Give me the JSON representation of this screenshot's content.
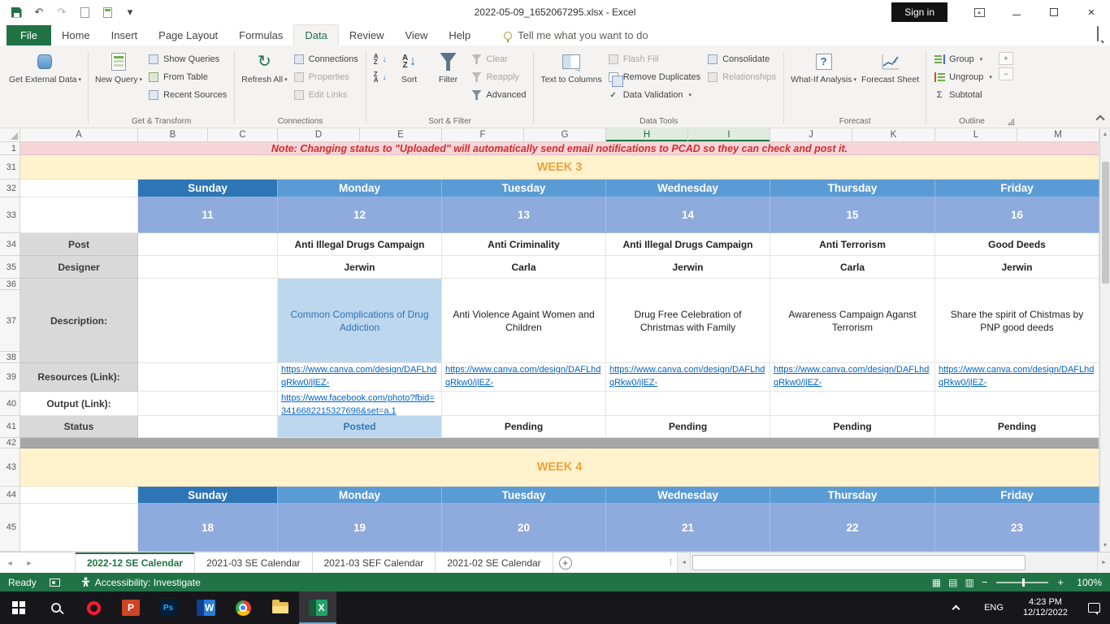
{
  "titlebar": {
    "title": "2022-05-09_1652067295.xlsx  -  Excel",
    "sign_in": "Sign in"
  },
  "tabs": {
    "file": "File",
    "home": "Home",
    "insert": "Insert",
    "page_layout": "Page Layout",
    "formulas": "Formulas",
    "data": "Data",
    "review": "Review",
    "view": "View",
    "help": "Help",
    "tell_me": "Tell me what you want to do"
  },
  "ribbon": {
    "get_external_data": "Get External Data",
    "new_query": "New Query",
    "show_queries": "Show Queries",
    "from_table": "From Table",
    "recent_sources": "Recent Sources",
    "get_transform_label": "Get & Transform",
    "refresh_all": "Refresh All",
    "connections": "Connections",
    "properties": "Properties",
    "edit_links": "Edit Links",
    "connections_label": "Connections",
    "sort": "Sort",
    "filter": "Filter",
    "clear": "Clear",
    "reapply": "Reapply",
    "advanced": "Advanced",
    "sort_filter_label": "Sort & Filter",
    "text_to_columns": "Text to Columns",
    "flash_fill": "Flash Fill",
    "remove_duplicates": "Remove Duplicates",
    "data_validation": "Data Validation",
    "consolidate": "Consolidate",
    "relationships": "Relationships",
    "data_tools_label": "Data Tools",
    "what_if_analysis": "What-If Analysis",
    "forecast_sheet": "Forecast Sheet",
    "forecast_label": "Forecast",
    "group": "Group",
    "ungroup": "Ungroup",
    "subtotal": "Subtotal",
    "outline_label": "Outline"
  },
  "grid": {
    "columns": [
      "A",
      "B",
      "C",
      "D",
      "E",
      "F",
      "G",
      "H",
      "I",
      "J",
      "K",
      "L",
      "M"
    ],
    "rows": [
      "1",
      "31",
      "32",
      "33",
      "34",
      "35",
      "36",
      "37",
      "38",
      "39",
      "40",
      "41",
      "42",
      "43",
      "44",
      "45"
    ],
    "note": "Note: Changing status to \"Uploaded\" will automatically send email notifications to PCAD so they can check and post it.",
    "labels": {
      "post": "Post",
      "designer": "Designer",
      "description": "Description:",
      "resources": "Resources (Link):",
      "output": "Output (Link):",
      "status": "Status"
    },
    "week3": {
      "title": "WEEK 3",
      "days": [
        "Sunday",
        "Monday",
        "Tuesday",
        "Wednesday",
        "Thursday",
        "Friday"
      ],
      "dates": [
        "11",
        "12",
        "13",
        "14",
        "15",
        "16"
      ],
      "posts": [
        "",
        "Anti Illegal Drugs Campaign",
        "Anti Criminality",
        "Anti Illegal Drugs Campaign",
        "Anti Terrorism",
        "Good Deeds"
      ],
      "designers": [
        "",
        "Jerwin",
        "Carla",
        "Jerwin",
        "Carla",
        "Jerwin"
      ],
      "descriptions": [
        "",
        "Common Complications of Drug Addiction",
        "Anti Violence Againt Women and Children",
        "Drug Free Celebration of Christmas with Family",
        "Awareness Campaign Aganst Terrorism",
        "Share the spirit of Chistmas by PNP good deeds"
      ],
      "resources": [
        "",
        "https://www.canva.com/design/DAFLhdqRkw0/jlEZ-",
        "https://www.canva.com/design/DAFLhdqRkw0/jlEZ-",
        "https://www.canva.com/design/DAFLhdqRkw0/jlEZ-",
        "https://www.canva.com/design/DAFLhdqRkw0/jlEZ-",
        "https://www.canva.com/design/DAFLhdqRkw0/jlEZ-"
      ],
      "outputs": [
        "",
        "https://www.facebook.com/photo?fbid=3416682215327696&set=a.1",
        "",
        "",
        "",
        ""
      ],
      "statuses": [
        "",
        "Posted",
        "Pending",
        "Pending",
        "Pending",
        "Pending"
      ]
    },
    "week4": {
      "title": "WEEK 4",
      "days": [
        "Sunday",
        "Monday",
        "Tuesday",
        "Wednesday",
        "Thursday",
        "Friday"
      ],
      "dates": [
        "18",
        "19",
        "20",
        "21",
        "22",
        "23"
      ]
    }
  },
  "sheet_tabs": {
    "tab1": "2022-12 SE Calendar",
    "tab2": "2021-03 SE Calendar",
    "tab3": "2021-03 SEF Calendar",
    "tab4": "2021-02 SE Calendar"
  },
  "status_bar": {
    "ready": "Ready",
    "accessibility": "Accessibility: Investigate",
    "zoom": "100%"
  },
  "taskbar": {
    "language": "ENG",
    "time": "4:23 PM",
    "date": "12/12/2022"
  },
  "icons": {
    "caret_down": "▾",
    "undo": "↶",
    "redo": "↷",
    "refresh": "↻",
    "sort_arrow": "↓",
    "up_arrow": "▲",
    "down_arrow": "▼",
    "left_arrow": "◄",
    "right_arrow": "►",
    "plus": "+",
    "minus": "−",
    "check": "✓",
    "sigma": "Σ",
    "view_normal": "▦",
    "view_layout": "▤",
    "view_break": "▥",
    "close": "×",
    "dots": "⁞"
  },
  "colors": {
    "excel_green": "#217346",
    "day_header_blue": "#5b9bd5",
    "sunday_blue": "#2e75b6",
    "date_blue": "#8faadc",
    "highlight_blue": "#bdd7ee",
    "week_bg": "#fff2cc",
    "week_text": "#eda13c",
    "note_bg": "#f6d5d9",
    "note_text": "#d02d2d",
    "label_gray": "#d9d9d9",
    "link_blue": "#0563c1"
  }
}
